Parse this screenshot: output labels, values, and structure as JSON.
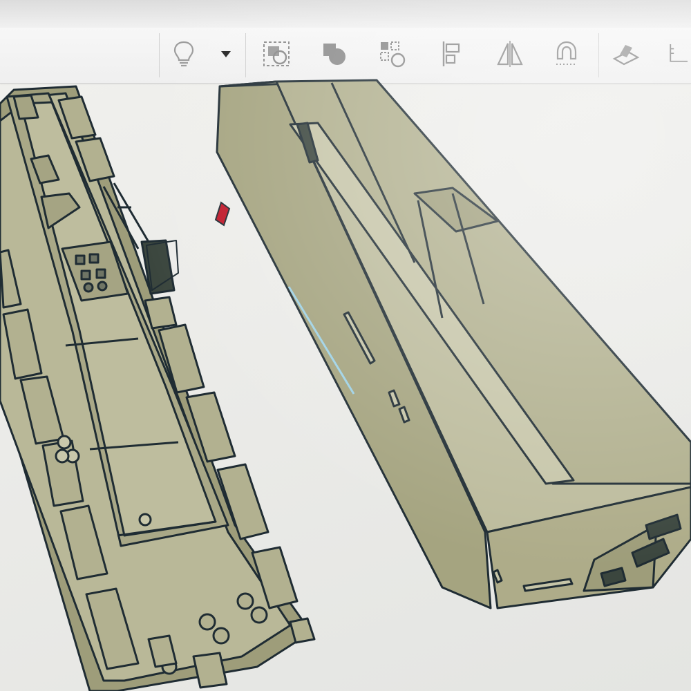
{
  "toolbar": {
    "tools": [
      {
        "name": "lightbulb-icon",
        "tooltip": ""
      },
      {
        "name": "dropdown-arrow-icon",
        "tooltip": ""
      },
      {
        "name": "group-icon",
        "tooltip": ""
      },
      {
        "name": "shape-union-icon",
        "tooltip": ""
      },
      {
        "name": "select-icon",
        "tooltip": ""
      },
      {
        "name": "align-icon",
        "tooltip": ""
      },
      {
        "name": "mirror-icon",
        "tooltip": ""
      },
      {
        "name": "magnet-icon",
        "tooltip": ""
      },
      {
        "name": "workplane-icon",
        "tooltip": ""
      },
      {
        "name": "ruler-icon",
        "tooltip": ""
      }
    ]
  },
  "workplane": {
    "objects": [
      {
        "name": "ship-deck-model"
      },
      {
        "name": "ship-hull-model"
      },
      {
        "name": "selected-marker"
      }
    ]
  },
  "colors": {
    "model_fill": "#b6b695",
    "model_fill_dark": "#9c9b78",
    "model_edge": "#1f2c33",
    "canvas_bg": "#eeeeeb",
    "toolbar_bg": "#f3f3f3",
    "icon_gray": "#8a8a8a",
    "marker_red": "#c0192a",
    "selection_blue": "#9fd2e6"
  }
}
